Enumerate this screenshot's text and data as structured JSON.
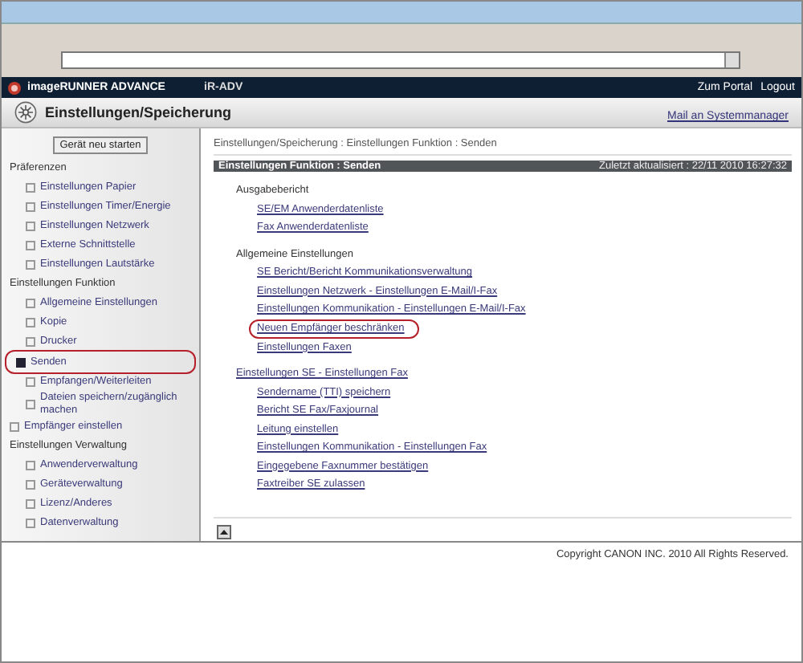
{
  "header": {
    "product": "imageRUNNER ADVANCE",
    "model": "iR-ADV",
    "links": [
      "Zum Portal",
      "Logout"
    ]
  },
  "title_bar": {
    "title": "Einstellungen/Speicherung",
    "mail_link": "Mail an Systemmanager"
  },
  "sidebar": {
    "restart_button": "Gerät neu starten",
    "items": [
      {
        "label": "Präferenzen",
        "children": [
          {
            "label": "Einstellungen Papier",
            "selected": false,
            "highlight": false
          },
          {
            "label": "Einstellungen Timer/Energie",
            "selected": false,
            "highlight": false
          },
          {
            "label": "Einstellungen Netzwerk",
            "selected": false,
            "highlight": false
          },
          {
            "label": "Externe Schnittstelle",
            "selected": false,
            "highlight": false
          },
          {
            "label": "Einstellungen Lautstärke",
            "selected": false,
            "highlight": false
          }
        ]
      },
      {
        "label": "Einstellungen Funktion",
        "children": [
          {
            "label": "Allgemeine Einstellungen",
            "selected": false,
            "highlight": false
          },
          {
            "label": "Kopie",
            "selected": false,
            "highlight": false
          },
          {
            "label": "Drucker",
            "selected": false,
            "highlight": false
          },
          {
            "label": "Senden",
            "selected": true,
            "highlight": true
          },
          {
            "label": "Empfangen/Weiterleiten",
            "selected": false,
            "highlight": false
          },
          {
            "label": "Dateien speichern/zugänglich machen",
            "selected": false,
            "highlight": false
          }
        ]
      },
      {
        "label": "Empfänger einstellen",
        "selected": false,
        "highlight": false
      },
      {
        "label": "Einstellungen Verwaltung",
        "children": [
          {
            "label": "Anwenderverwaltung",
            "selected": false,
            "highlight": false
          },
          {
            "label": "Geräteverwaltung",
            "selected": false,
            "highlight": false
          },
          {
            "label": "Lizenz/Anderes",
            "selected": false,
            "highlight": false
          },
          {
            "label": "Datenverwaltung",
            "selected": false,
            "highlight": false
          }
        ]
      }
    ]
  },
  "breadcrumb": "Einstellungen/Speicherung : Einstellungen Funktion : Senden",
  "panel": {
    "title": "Einstellungen Funktion : Senden",
    "updated": "Zuletzt aktualisiert : 22/11 2010 16:27:32"
  },
  "sections": [
    {
      "heading": "Ausgabebericht",
      "link": false,
      "links": [
        {
          "label": "SE/EM Anwenderdatenliste",
          "highlight": false
        },
        {
          "label": "Fax Anwenderdatenliste",
          "highlight": false
        }
      ]
    },
    {
      "heading": "Allgemeine Einstellungen",
      "link": false,
      "links": [
        {
          "label": "SE Bericht/Bericht Kommunikationsverwaltung",
          "highlight": false
        },
        {
          "label": "Einstellungen Netzwerk - Einstellungen E-Mail/I-Fax",
          "highlight": false
        },
        {
          "label": "Einstellungen Kommunikation - Einstellungen E-Mail/I-Fax",
          "highlight": false
        },
        {
          "label": "Neuen Empfänger beschränken",
          "highlight": true
        },
        {
          "label": "Einstellungen Faxen",
          "highlight": false
        }
      ]
    },
    {
      "heading": "Einstellungen SE - Einstellungen Fax",
      "link": true,
      "links": [
        {
          "label": "Sendername (TTI) speichern",
          "highlight": false
        },
        {
          "label": "Bericht SE Fax/Faxjournal",
          "highlight": false
        },
        {
          "label": "Leitung einstellen",
          "highlight": false
        },
        {
          "label": "Einstellungen Kommunikation - Einstellungen Fax",
          "highlight": false
        },
        {
          "label": "Eingegebene Faxnummer bestätigen",
          "highlight": false
        },
        {
          "label": "Faxtreiber SE zulassen",
          "highlight": false
        }
      ]
    }
  ],
  "footer": "Copyright CANON INC. 2010 All Rights Reserved."
}
